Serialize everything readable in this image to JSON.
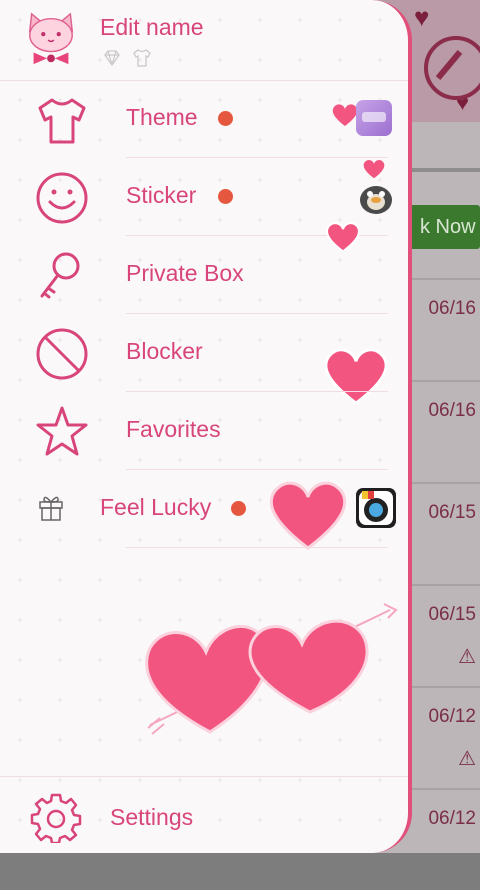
{
  "profile": {
    "name_label": "Edit name"
  },
  "menu": {
    "theme": "Theme",
    "sticker": "Sticker",
    "private_box": "Private Box",
    "blocker": "Blocker",
    "favorites": "Favorites",
    "feel_lucky": "Feel Lucky"
  },
  "settings": {
    "label": "Settings"
  },
  "background": {
    "now_button": "k Now",
    "dates": [
      "06/16",
      "06/16",
      "06/15",
      "06/15",
      "06/12",
      "06/12"
    ],
    "warn_icon": "⚠"
  },
  "colors": {
    "accent": "#d8457b",
    "border": "#e0507a",
    "dot": "#e5573f",
    "heart": "#f2557f"
  },
  "icons": [
    "cat-avatar-icon",
    "diamond-icon",
    "shirt-icon",
    "smiley-icon",
    "key-icon",
    "block-icon",
    "star-icon",
    "gift-icon",
    "gear-icon",
    "heart-icon"
  ]
}
